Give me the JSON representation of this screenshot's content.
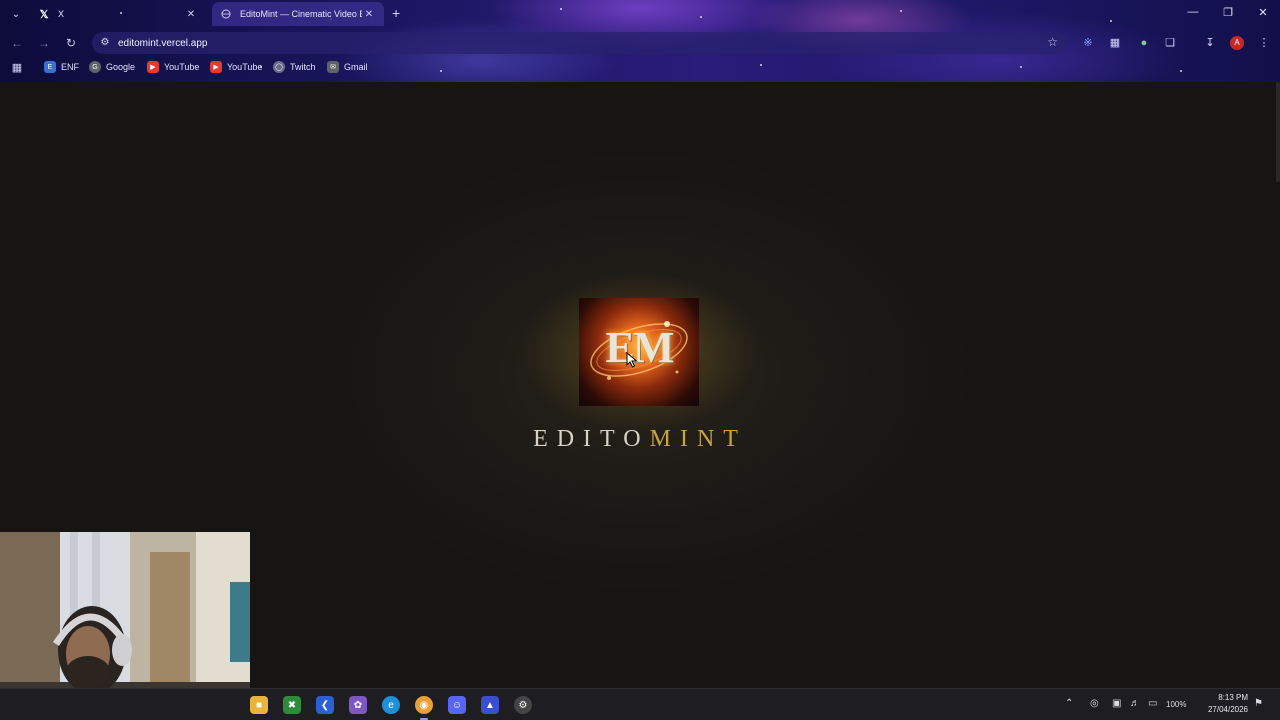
{
  "browser": {
    "tabs": [
      {
        "title": "X",
        "favicon": "x-logo-icon",
        "active": false
      },
      {
        "title": "EditoMint — Cinematic Video E",
        "favicon": "globe-icon",
        "active": true
      }
    ],
    "url": "editomint.vercel.app",
    "bookmarks": [
      {
        "label": "ENF",
        "icon": "enf-icon",
        "color": "#3b6fd8"
      },
      {
        "label": "Google",
        "icon": "google-icon",
        "color": "#5f6368"
      },
      {
        "label": "YouTube",
        "icon": "youtube-icon",
        "color": "#e53935"
      },
      {
        "label": "YouTube",
        "icon": "youtube-icon",
        "color": "#e53935"
      },
      {
        "label": "Twitch",
        "icon": "globe-icon",
        "color": "#6b6b8a"
      },
      {
        "label": "Gmail",
        "icon": "gmail-icon",
        "color": "#5f6368"
      }
    ],
    "profile_initial": "A"
  },
  "page": {
    "logo_text": "EM",
    "brand_part1": "EDITO",
    "brand_part2": "MINT",
    "brand_color_primary": "#d8d2c4",
    "brand_color_accent": "#c9a43c"
  },
  "taskbar": {
    "battery": "100%",
    "time": "8:13 PM",
    "date": "27/04/2026"
  }
}
